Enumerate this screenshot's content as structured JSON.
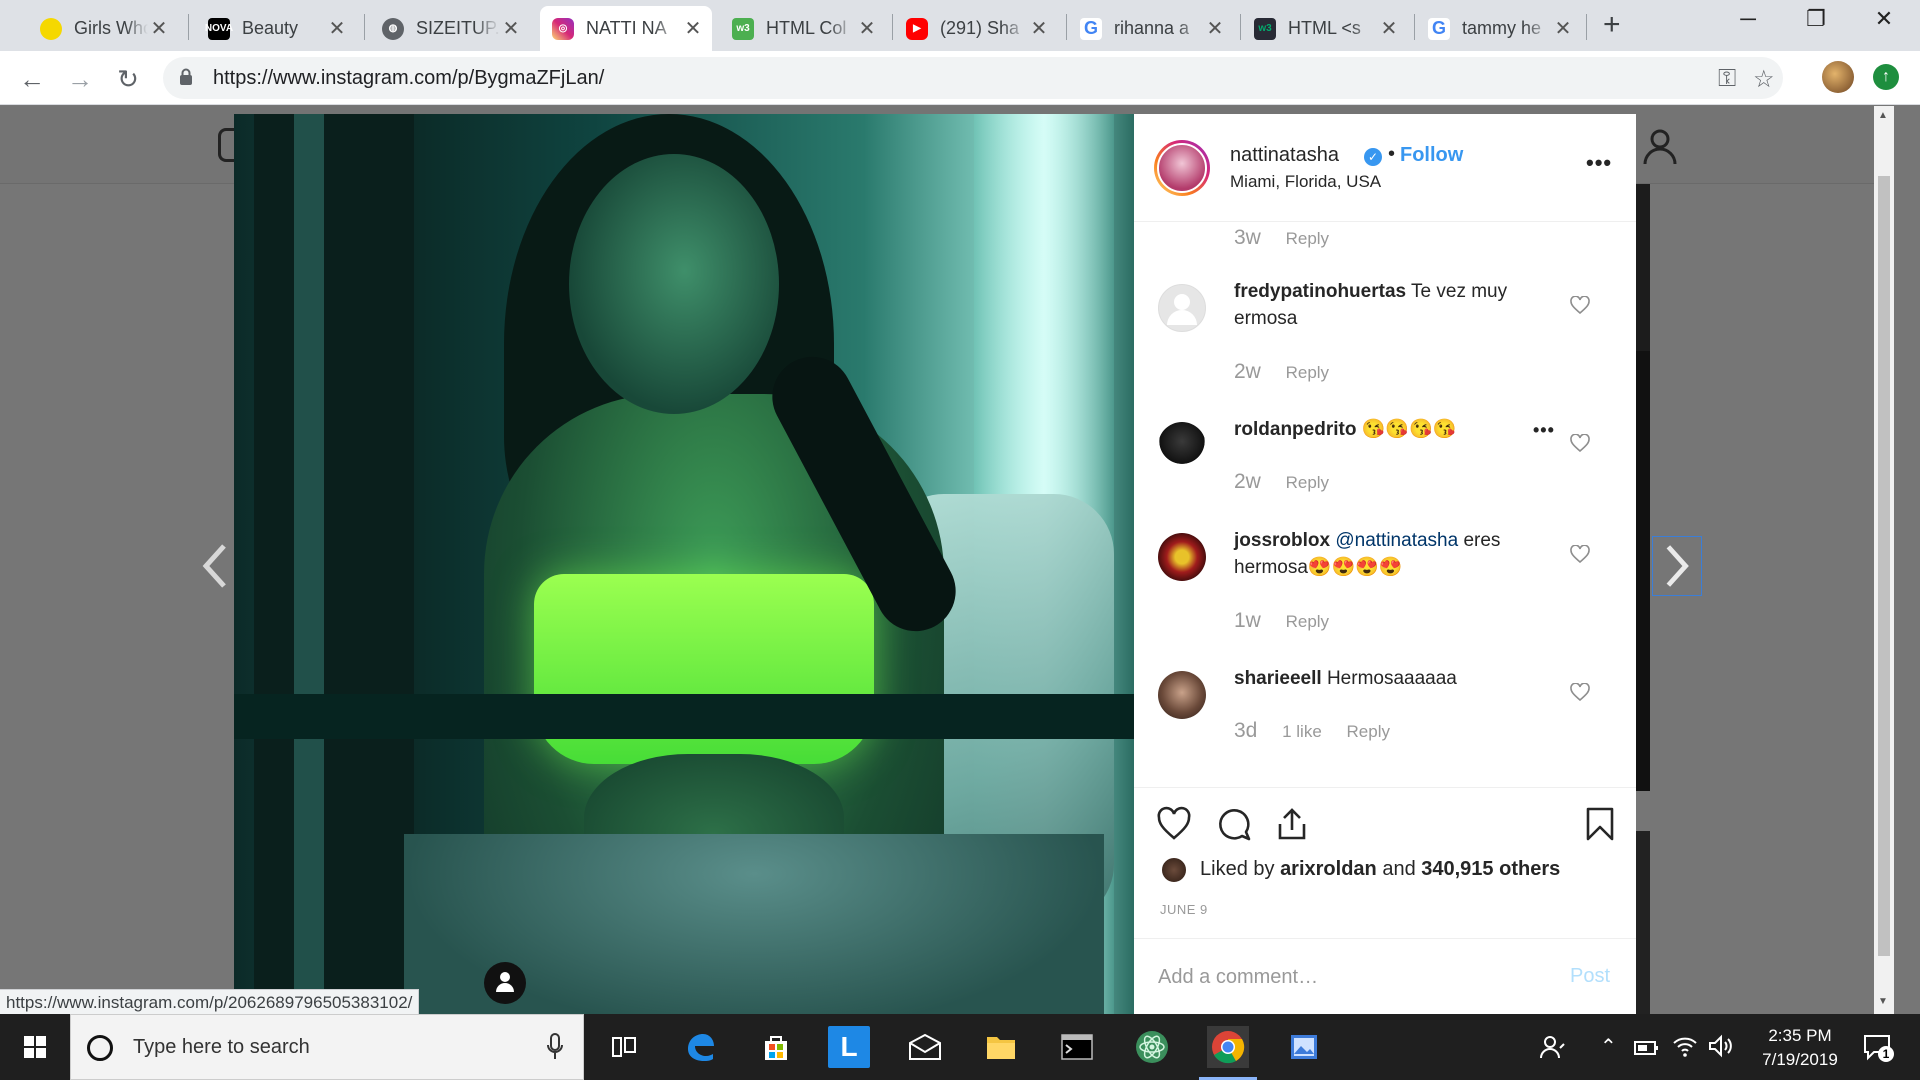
{
  "browser": {
    "tabs": [
      {
        "title": "Girls Who",
        "favicon": "girls-who-code-icon",
        "color": "#f5d800"
      },
      {
        "title": "Beauty",
        "favicon": "nova-icon",
        "color": "#000000"
      },
      {
        "title": "SIZEITUP.",
        "favicon": "globe-icon",
        "color": "#5f6368"
      },
      {
        "title": "NATTI NA",
        "favicon": "instagram-icon",
        "color": "#c13584"
      },
      {
        "title": "HTML Col",
        "favicon": "w3schools-icon",
        "color": "#4caf50"
      },
      {
        "title": "(291) Sha",
        "favicon": "youtube-icon",
        "color": "#ff0000"
      },
      {
        "title": "rihanna a",
        "favicon": "google-icon",
        "color": "#4285f4"
      },
      {
        "title": "HTML <s",
        "favicon": "w3schools-icon",
        "color": "#282a35"
      },
      {
        "title": "tammy he",
        "favicon": "google-icon",
        "color": "#4285f4"
      }
    ],
    "active_tab_index": 3,
    "url": "https://www.instagram.com/p/BygmaZFjLan/",
    "status_url": "https://www.instagram.com/p/2062689796505383102/"
  },
  "post": {
    "username": "nattinatasha",
    "follow_label": "Follow",
    "separator": "•",
    "location": "Miami, Florida, USA",
    "more_label": "•••",
    "liked_by_prefix": "Liked by ",
    "liked_by_user": "arixroldan",
    "liked_by_and": " and ",
    "liked_by_others": "340,915 others",
    "date": "JUNE 9",
    "comment_placeholder": "Add a comment…",
    "post_label": "Post"
  },
  "comments": [
    {
      "user": "",
      "text": "",
      "age": "3w",
      "likes": "",
      "reply": "Reply"
    },
    {
      "user": "fredypatinohuertas",
      "text": " Te vez muy ermosa",
      "age": "2w",
      "likes": "",
      "reply": "Reply"
    },
    {
      "user": "roldanpedrito",
      "text": " 😘😘😘😘",
      "age": "2w",
      "likes": "",
      "reply": "Reply"
    },
    {
      "user": "jossroblox",
      "mention": "@nattinatasha",
      "text": " eres hermosa😍😍😍😍",
      "age": "1w",
      "likes": "",
      "reply": "Reply"
    },
    {
      "user": "sharieeell",
      "text": " Hermosaaaaaa",
      "age": "3d",
      "likes": "1 like",
      "reply": "Reply"
    }
  ],
  "taskbar": {
    "search_placeholder": "Type here to search",
    "time": "2:35 PM",
    "date": "7/19/2019",
    "notification_count": "1"
  },
  "colors": {
    "accent": "#3897f0",
    "instagram_gradient": [
      "#feda75",
      "#fa7e1e",
      "#d62976",
      "#962fbf"
    ]
  }
}
